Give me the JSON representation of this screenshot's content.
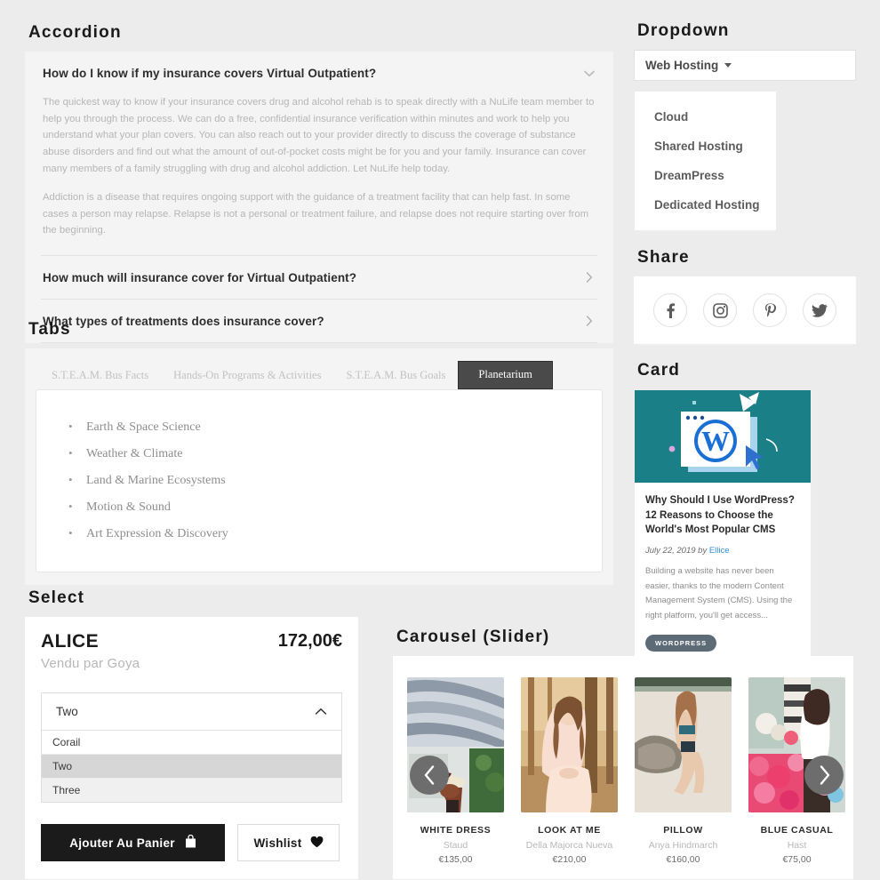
{
  "sections": {
    "accordion": "Accordion",
    "tabs": "Tabs",
    "select": "Select",
    "dropdown": "Dropdown",
    "share": "Share",
    "card": "Card",
    "carousel": "Carousel (Slider)"
  },
  "accordion": {
    "items": [
      {
        "question": "How do I know if my insurance covers Virtual Outpatient?",
        "expanded": true,
        "icon": "chevron-down-icon",
        "paragraphs": [
          "The quickest way to know if your insurance covers drug and alcohol rehab is to speak directly with a NuLife team member to help you through the process. We can do a free, confidential insurance verification within minutes and work to help you understand what your plan covers. You can also reach out to your provider directly to discuss the coverage of substance abuse disorders and find out what the amount of out-of-pocket costs might be for you and your family. Insurance can cover many members of a family struggling with drug and alcohol addiction. Let NuLife help today.",
          "Addiction is a disease that requires ongoing support with the guidance of a treatment facility that can help fast. In some cases a person may relapse. Relapse is not a personal or treatment failure, and relapse does not require starting over from the beginning."
        ]
      },
      {
        "question": "How much will insurance cover for Virtual Outpatient?",
        "expanded": false,
        "icon": "chevron-right-icon",
        "paragraphs": []
      },
      {
        "question": "What types of treatments does insurance cover?",
        "expanded": false,
        "icon": "chevron-right-icon",
        "paragraphs": []
      }
    ]
  },
  "tabs": {
    "items": [
      {
        "label": "S.T.E.A.M. Bus Facts",
        "active": false
      },
      {
        "label": "Hands-On Programs & Activities",
        "active": false
      },
      {
        "label": "S.T.E.A.M. Bus Goals",
        "active": false
      },
      {
        "label": "Planetarium",
        "active": true
      }
    ],
    "content_list": [
      "Earth & Space Science",
      "Weather & Climate",
      "Land & Marine Ecosystems",
      "Motion & Sound",
      "Art Expression & Discovery"
    ]
  },
  "product": {
    "name": "ALICE",
    "price": "172,00€",
    "vendor": "Vendu par Goya",
    "select": {
      "selected": "Two",
      "caret_icon": "chevron-up-icon",
      "options": [
        {
          "label": "Corail",
          "state": "normal"
        },
        {
          "label": "Two",
          "state": "selected"
        },
        {
          "label": "Three",
          "state": "alt"
        }
      ]
    },
    "add_to_cart_label": "Ajouter Au Panier",
    "add_to_cart_icon": "shopping-bag-icon",
    "wishlist_label": "Wishlist",
    "wishlist_icon": "heart-icon"
  },
  "dropdown": {
    "toggle_label": "Web Hosting",
    "toggle_icon": "caret-down-icon",
    "items": [
      "Cloud",
      "Shared Hosting",
      "DreamPress",
      "Dedicated Hosting"
    ]
  },
  "share": {
    "icons": [
      "facebook-icon",
      "instagram-icon",
      "pinterest-icon",
      "twitter-icon"
    ]
  },
  "card": {
    "image_alt": "wordpress-illustration",
    "image_bg": "#1a7f86",
    "title": "Why Should I Use WordPress? 12 Reasons to Choose the World's Most Popular CMS",
    "date": "July 22, 2019",
    "by_label": "by",
    "author": "Ellice",
    "author_color": "#2f8ed6",
    "excerpt": "Building a website has never been easier, thanks to the modern Content Management System (CMS). Using the right platform, you'll get access...",
    "tag": "WORDPRESS",
    "tag_color": "#5d6b77"
  },
  "carousel": {
    "prev_icon": "chevron-left-icon",
    "next_icon": "chevron-right-icon",
    "items": [
      {
        "title": "WHITE DRESS",
        "brand": "Staud",
        "price": "€135,00",
        "image_alt": "woman-in-greenhouse"
      },
      {
        "title": "LOOK AT ME",
        "brand": "Della Majorca Nueva",
        "price": "€210,00",
        "image_alt": "woman-in-peach-dress"
      },
      {
        "title": "PILLOW",
        "brand": "Anya Hindmarch",
        "price": "€160,00",
        "image_alt": "woman-on-beach-rock"
      },
      {
        "title": "BLUE CASUAL",
        "brand": "Hast",
        "price": "€75,00",
        "image_alt": "woman-at-flower-market"
      }
    ]
  }
}
